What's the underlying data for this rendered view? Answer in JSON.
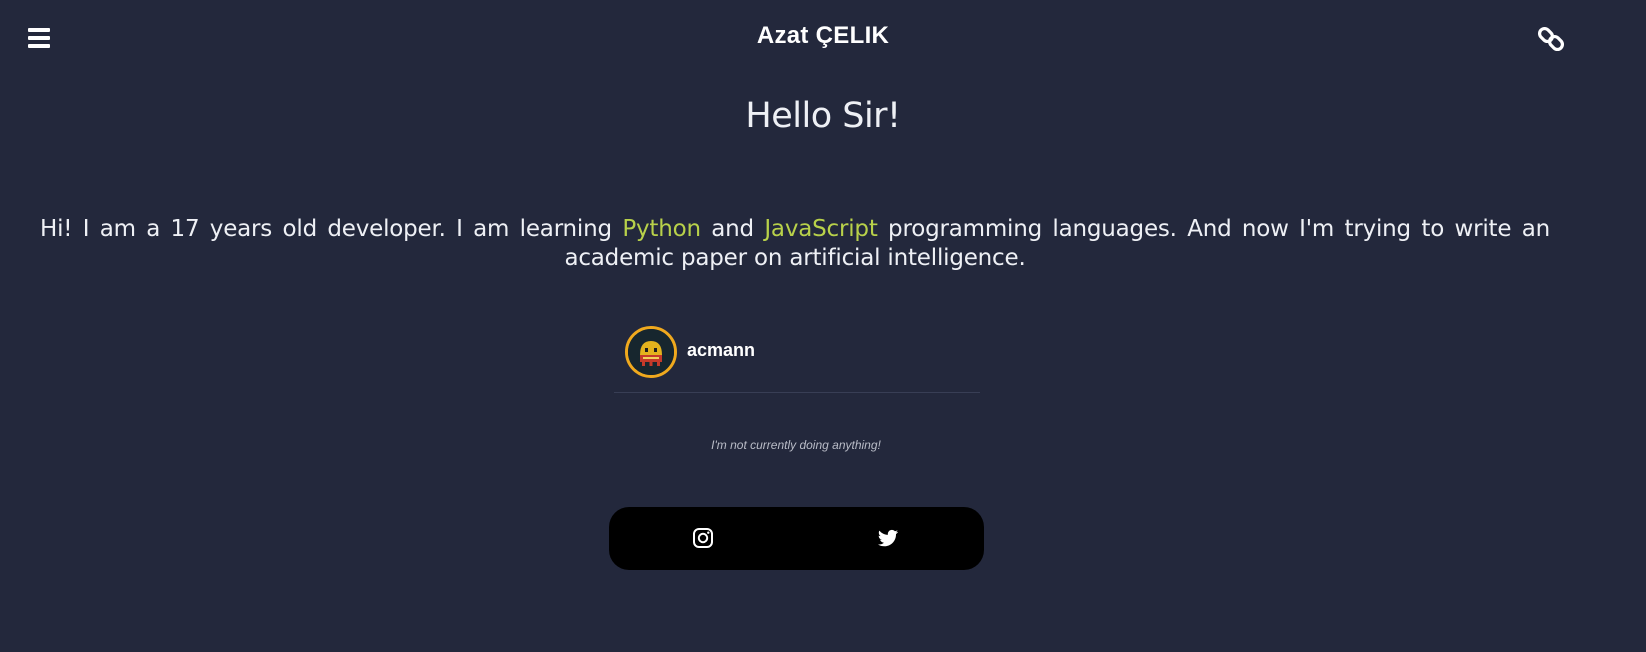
{
  "header": {
    "title": "Azat ÇELIK",
    "menu_icon": "hamburger-menu-icon",
    "link_icon": "chain-link-icon"
  },
  "main": {
    "greeting": "Hello Sir!",
    "intro": {
      "part1": "Hi! I am a 17 years old developer. I am learning ",
      "lang1": "Python",
      "part2": " and ",
      "lang2": "JavaScript",
      "part3": " programming languages. And now I'm trying to write an academic paper on artificial intelligence."
    }
  },
  "profile": {
    "username": "acmann",
    "status": "I'm not currently doing anything!"
  },
  "social": {
    "items": [
      {
        "icon": "instagram-icon"
      },
      {
        "icon": "twitter-icon"
      }
    ]
  },
  "colors": {
    "background": "#23283c",
    "highlight": "#b8d14a",
    "avatar_ring": "#f0a91e"
  }
}
